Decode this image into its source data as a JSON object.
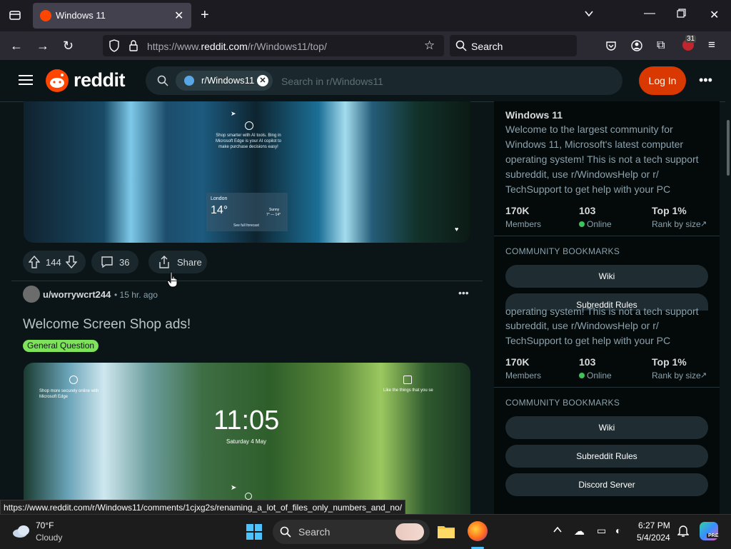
{
  "browser": {
    "tab_title": "Windows 11",
    "url_prefix": "https://www.",
    "url_main": "reddit.com",
    "url_path": "/r/Windows11/top/",
    "search_placeholder": "Search",
    "notification_badge": "31"
  },
  "header": {
    "logo_text": "reddit",
    "search_chip": "r/Windows11",
    "search_placeholder": "Search in r/Windows11",
    "login_label": "Log In"
  },
  "post1": {
    "img_text_1": "Shop smarter with AI tools. Bing in Microsoft Edge is your AI copilot to make purchase decisions easy!",
    "img_weather_city": "London",
    "img_weather_temp": "14°",
    "img_weather_cond": "Sunny",
    "img_weather_range": "7° — 14°",
    "img_weather_link": "See full forecast",
    "upvotes": "144",
    "comments": "36",
    "share_label": "Share"
  },
  "post2": {
    "username": "u/worrywcrt244",
    "time": "• 15 hr. ago",
    "title": "Welcome Screen Shop ads!",
    "flair": "General Question",
    "img_text_left": "Shop more securely online with Microsoft Edge",
    "img_text_right": "Like the things that you se",
    "img_clock": "11:05",
    "img_date": "Saturday 4 May"
  },
  "sidebar": {
    "title": "Windows 11",
    "description": "Welcome to the largest community for Windows 11, Microsoft's latest computer operating system! This is not a tech support subreddit, use r/WindowsHelp or r/ TechSupport to get help with your PC",
    "description_tail_1": "operating system! This is not a tech support",
    "description_tail_2": "subreddit, use r/WindowsHelp or r/",
    "description_tail_3": "TechSupport to get help with your PC",
    "members_num": "170K",
    "members_label": "Members",
    "online_num": "103",
    "online_label": "Online",
    "rank_num": "Top 1%",
    "rank_label": "Rank by size",
    "bookmarks_heading": "COMMUNITY BOOKMARKS",
    "bookmark_wiki": "Wiki",
    "bookmark_rules": "Subreddit Rules",
    "bookmark_discord": "Discord Server"
  },
  "status_url": "https://www.reddit.com/r/Windows11/comments/1cjxg2s/renaming_a_lot_of_files_only_numbers_and_no/",
  "taskbar": {
    "weather_temp": "70°F",
    "weather_cond": "Cloudy",
    "search_label": "Search",
    "time": "6:27 PM",
    "date": "5/4/2024",
    "copilot_badge": "PRE"
  }
}
